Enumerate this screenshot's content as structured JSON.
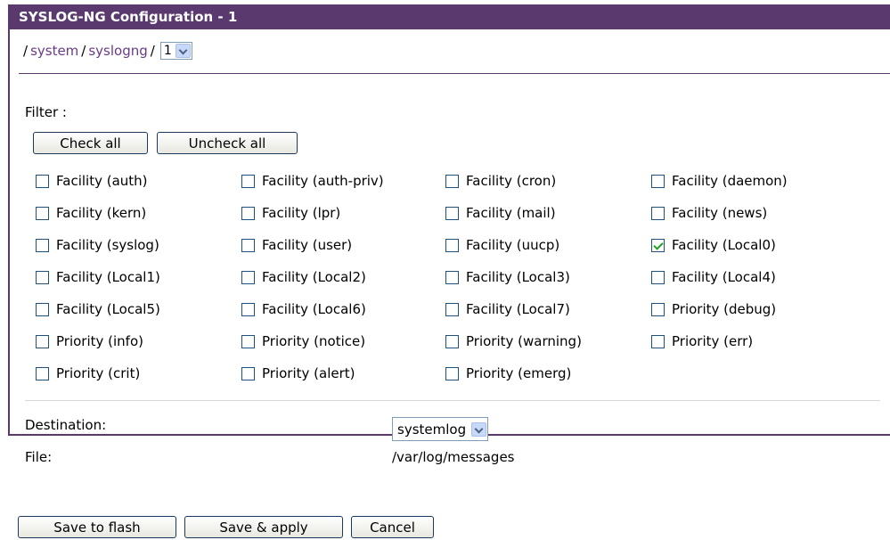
{
  "title": "SYSLOG-NG Configuration - 1",
  "breadcrumb": {
    "separator": "/",
    "items": [
      "system",
      "syslogng"
    ],
    "instance_value": "1"
  },
  "filter": {
    "label": "Filter :",
    "check_all_label": "Check all",
    "uncheck_all_label": "Uncheck all",
    "options": [
      {
        "label": "Facility (auth)",
        "checked": false
      },
      {
        "label": "Facility (auth-priv)",
        "checked": false
      },
      {
        "label": "Facility (cron)",
        "checked": false
      },
      {
        "label": "Facility (daemon)",
        "checked": false
      },
      {
        "label": "Facility (kern)",
        "checked": false
      },
      {
        "label": "Facility (lpr)",
        "checked": false
      },
      {
        "label": "Facility (mail)",
        "checked": false
      },
      {
        "label": "Facility (news)",
        "checked": false
      },
      {
        "label": "Facility (syslog)",
        "checked": false
      },
      {
        "label": "Facility (user)",
        "checked": false
      },
      {
        "label": "Facility (uucp)",
        "checked": false
      },
      {
        "label": "Facility (Local0)",
        "checked": true
      },
      {
        "label": "Facility (Local1)",
        "checked": false
      },
      {
        "label": "Facility (Local2)",
        "checked": false
      },
      {
        "label": "Facility (Local3)",
        "checked": false
      },
      {
        "label": "Facility (Local4)",
        "checked": false
      },
      {
        "label": "Facility (Local5)",
        "checked": false
      },
      {
        "label": "Facility (Local6)",
        "checked": false
      },
      {
        "label": "Facility (Local7)",
        "checked": false
      },
      {
        "label": "Priority (debug)",
        "checked": false
      },
      {
        "label": "Priority (info)",
        "checked": false
      },
      {
        "label": "Priority (notice)",
        "checked": false
      },
      {
        "label": "Priority (warning)",
        "checked": false
      },
      {
        "label": "Priority (err)",
        "checked": false
      },
      {
        "label": "Priority (crit)",
        "checked": false
      },
      {
        "label": "Priority (alert)",
        "checked": false
      },
      {
        "label": "Priority (emerg)",
        "checked": false
      }
    ]
  },
  "destination": {
    "label": "Destination:",
    "value": "systemlog"
  },
  "file": {
    "label": "File:",
    "value": "/var/log/messages"
  },
  "actions": {
    "save_flash_label": "Save to flash",
    "save_apply_label": "Save & apply",
    "cancel_label": "Cancel"
  },
  "colors": {
    "accent": "#5a3a6e",
    "link": "#6a3a8a",
    "check": "#21a121"
  }
}
